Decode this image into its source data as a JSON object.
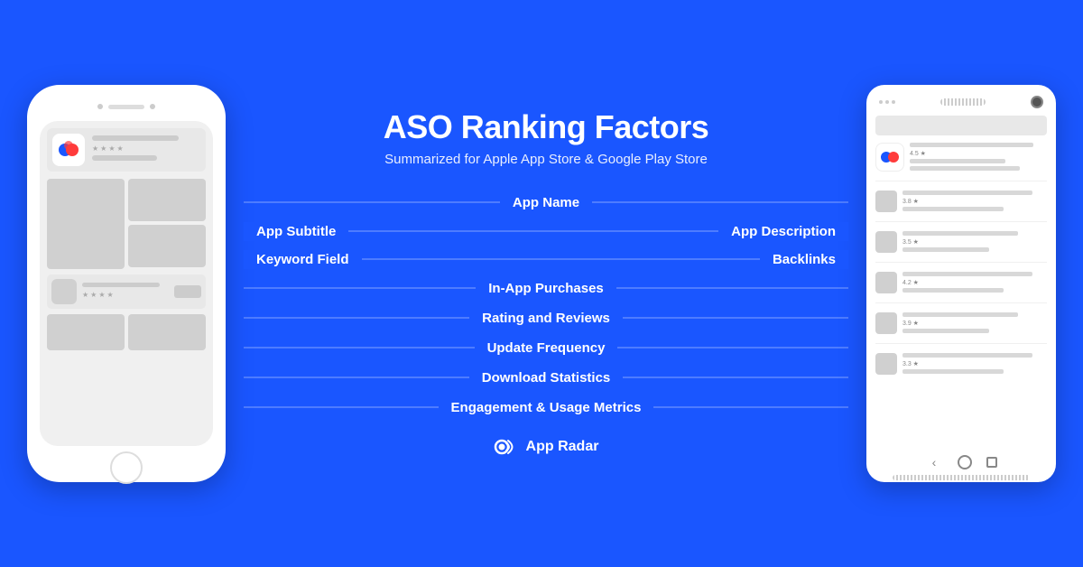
{
  "title": "ASO Ranking Factors",
  "subtitle": "Summarized for Apple App Store & Google Play Store",
  "factors": {
    "app_name": "App Name",
    "app_subtitle": "App Subtitle",
    "keyword_field": "Keyword Field",
    "app_description": "App Description",
    "backlinks": "Backlinks",
    "in_app_purchases": "In-App Purchases",
    "rating_and_reviews": "Rating and Reviews",
    "update_frequency": "Update Frequency",
    "download_statistics": "Download Statistics",
    "engagement_metrics": "Engagement & Usage Metrics"
  },
  "logo": {
    "text": "App Radar"
  },
  "iphone": {
    "stars": "★★★★",
    "stars2": "★★★★"
  },
  "android": {
    "ratings": [
      {
        "score": "4.5 ★"
      },
      {
        "score": "3.8 ★"
      },
      {
        "score": "3.5 ★"
      },
      {
        "score": "4.2 ★"
      },
      {
        "score": "3.9 ★"
      },
      {
        "score": "3.3 ★"
      }
    ]
  },
  "colors": {
    "background": "#1a56ff",
    "white": "#ffffff",
    "gray_light": "#d8d8d8",
    "gray_medium": "#b0b0b0"
  }
}
